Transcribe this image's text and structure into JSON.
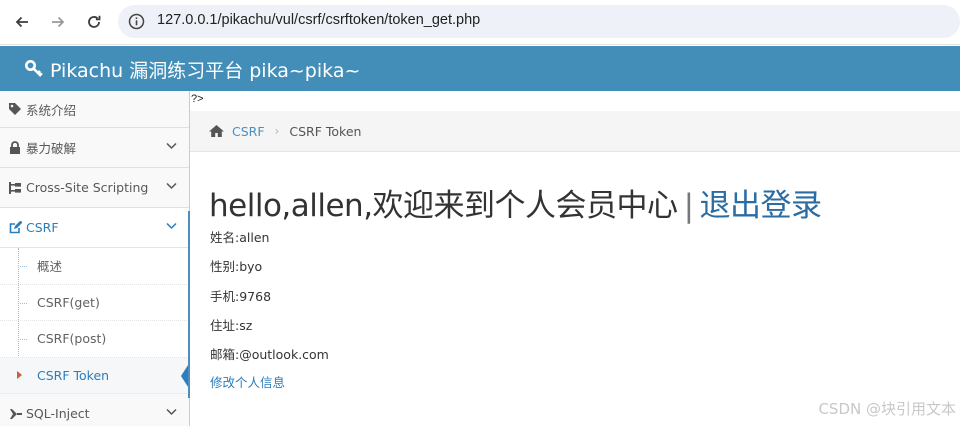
{
  "browser": {
    "url": "127.0.0.1/pikachu/vul/csrf/csrftoken/token_get.php"
  },
  "header": {
    "brand": "Pikachu 漏洞练习平台 pika~pika~"
  },
  "sidebar": {
    "items": [
      {
        "label": "系统介绍",
        "icon": "tag-icon"
      },
      {
        "label": "暴力破解",
        "icon": "lock-icon"
      },
      {
        "label": "Cross-Site Scripting",
        "icon": "sitemap-icon"
      },
      {
        "label": "CSRF",
        "icon": "edit-icon"
      },
      {
        "label": "SQL-Inject",
        "icon": "plane-icon"
      }
    ],
    "csrf_sub": [
      {
        "label": "概述"
      },
      {
        "label": "CSRF(get)"
      },
      {
        "label": "CSRF(post)"
      },
      {
        "label": "CSRF Token"
      }
    ]
  },
  "main": {
    "stray_text": "?>",
    "breadcrumb": {
      "link": "CSRF",
      "current": "CSRF Token"
    },
    "welcome": {
      "text": "hello,allen,欢迎来到个人会员中心",
      "divider": "|",
      "logout": "退出登录"
    },
    "profile": [
      "姓名:allen",
      "性别:byo",
      "手机:9768",
      "住址:sz",
      "邮箱:@outlook.com"
    ],
    "edit_link": "修改个人信息"
  },
  "watermark": "CSDN @块引用文本",
  "colors": {
    "header_bg": "#438eb9",
    "link": "#2b7dbc",
    "active_caret": "#c86139"
  }
}
